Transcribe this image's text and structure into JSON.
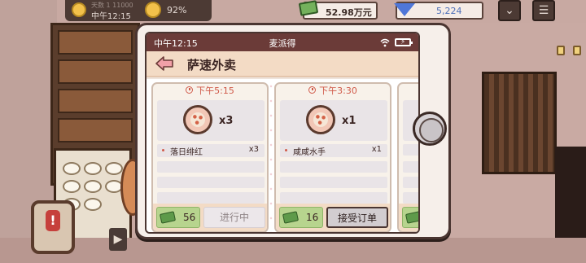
{
  "hud": {
    "day_label": "天数 1 11000",
    "time": "中午12:15",
    "mood_percent": "92%",
    "money": "52.98万元",
    "gems": "5,224",
    "colors": {
      "money_bg": "#74b15c",
      "gem": "#4f77d9"
    }
  },
  "phone": {
    "status_time": "中午12:15",
    "app_name": "麦派得",
    "page_title": "萨速外卖",
    "back_icon": "back-arrow-icon",
    "orders": [
      {
        "deadline": "下午5:15",
        "quantity_badge": "x3",
        "item_name": "落日绯红",
        "item_count": "x3",
        "reward": "56",
        "status_label": "进行中",
        "status": "in-progress"
      },
      {
        "deadline": "下午3:30",
        "quantity_badge": "x1",
        "item_name": "咸咸水手",
        "item_count": "x1",
        "reward": "16",
        "status_label": "接受订单",
        "status": "accept"
      }
    ],
    "colors": {
      "status_bar": "#6b3b38",
      "accent_red": "#d05a4a",
      "reward_green": "#b7d48e"
    }
  }
}
